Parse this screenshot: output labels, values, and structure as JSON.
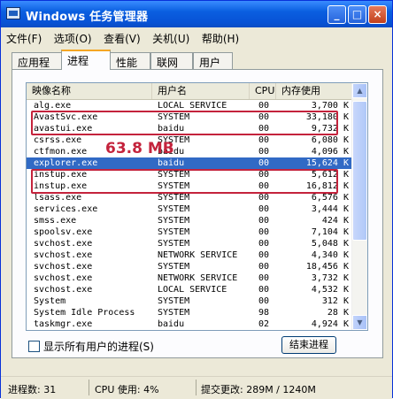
{
  "window": {
    "title": "Windows 任务管理器",
    "buttons": {
      "minimize": "_",
      "maximize": "□",
      "close": "×"
    }
  },
  "menu": [
    "文件(F)",
    "选项(O)",
    "查看(V)",
    "关机(U)",
    "帮助(H)"
  ],
  "tabs": [
    {
      "label": "应用程序",
      "active": false
    },
    {
      "label": "进程",
      "active": true
    },
    {
      "label": "性能",
      "active": false
    },
    {
      "label": "联网",
      "active": false
    },
    {
      "label": "用户",
      "active": false
    }
  ],
  "columns": {
    "name": "映像名称",
    "user": "用户名",
    "cpu": "CPU",
    "mem": "内存使用"
  },
  "processes": [
    {
      "name": "alg.exe",
      "user": "LOCAL SERVICE",
      "cpu": "00",
      "mem": "3,700 K"
    },
    {
      "name": "AvastSvc.exe",
      "user": "SYSTEM",
      "cpu": "00",
      "mem": "33,180 K"
    },
    {
      "name": "avastui.exe",
      "user": "baidu",
      "cpu": "00",
      "mem": "9,732 K"
    },
    {
      "name": "csrss.exe",
      "user": "SYSTEM",
      "cpu": "00",
      "mem": "6,080 K"
    },
    {
      "name": "ctfmon.exe",
      "user": "baidu",
      "cpu": "00",
      "mem": "4,096 K"
    },
    {
      "name": "explorer.exe",
      "user": "baidu",
      "cpu": "00",
      "mem": "15,624 K",
      "selected": true
    },
    {
      "name": "instup.exe",
      "user": "SYSTEM",
      "cpu": "00",
      "mem": "5,612 K"
    },
    {
      "name": "instup.exe",
      "user": "SYSTEM",
      "cpu": "00",
      "mem": "16,812 K"
    },
    {
      "name": "lsass.exe",
      "user": "SYSTEM",
      "cpu": "00",
      "mem": "6,576 K"
    },
    {
      "name": "services.exe",
      "user": "SYSTEM",
      "cpu": "00",
      "mem": "3,444 K"
    },
    {
      "name": "smss.exe",
      "user": "SYSTEM",
      "cpu": "00",
      "mem": "424 K"
    },
    {
      "name": "spoolsv.exe",
      "user": "SYSTEM",
      "cpu": "00",
      "mem": "7,104 K"
    },
    {
      "name": "svchost.exe",
      "user": "SYSTEM",
      "cpu": "00",
      "mem": "5,048 K"
    },
    {
      "name": "svchost.exe",
      "user": "NETWORK SERVICE",
      "cpu": "00",
      "mem": "4,340 K"
    },
    {
      "name": "svchost.exe",
      "user": "SYSTEM",
      "cpu": "00",
      "mem": "18,456 K"
    },
    {
      "name": "svchost.exe",
      "user": "NETWORK SERVICE",
      "cpu": "00",
      "mem": "3,732 K"
    },
    {
      "name": "svchost.exe",
      "user": "LOCAL SERVICE",
      "cpu": "00",
      "mem": "4,532 K"
    },
    {
      "name": "System",
      "user": "SYSTEM",
      "cpu": "00",
      "mem": "312 K"
    },
    {
      "name": "System Idle Process",
      "user": "SYSTEM",
      "cpu": "98",
      "mem": "28 K"
    },
    {
      "name": "taskmgr.exe",
      "user": "baidu",
      "cpu": "02",
      "mem": "4,924 K"
    }
  ],
  "annotation": {
    "text": "63.8 MB",
    "color": "#c4233c"
  },
  "show_all_users": "显示所有用户的进程(S)",
  "end_process": "结束进程",
  "status": {
    "processes": "进程数: 31",
    "cpu": "CPU 使用: 4%",
    "commit": "提交更改: 289M / 1240M"
  },
  "colors": {
    "titlebar": "#0a5fe0",
    "selection": "#316ac5",
    "annotation": "#c4233c"
  }
}
